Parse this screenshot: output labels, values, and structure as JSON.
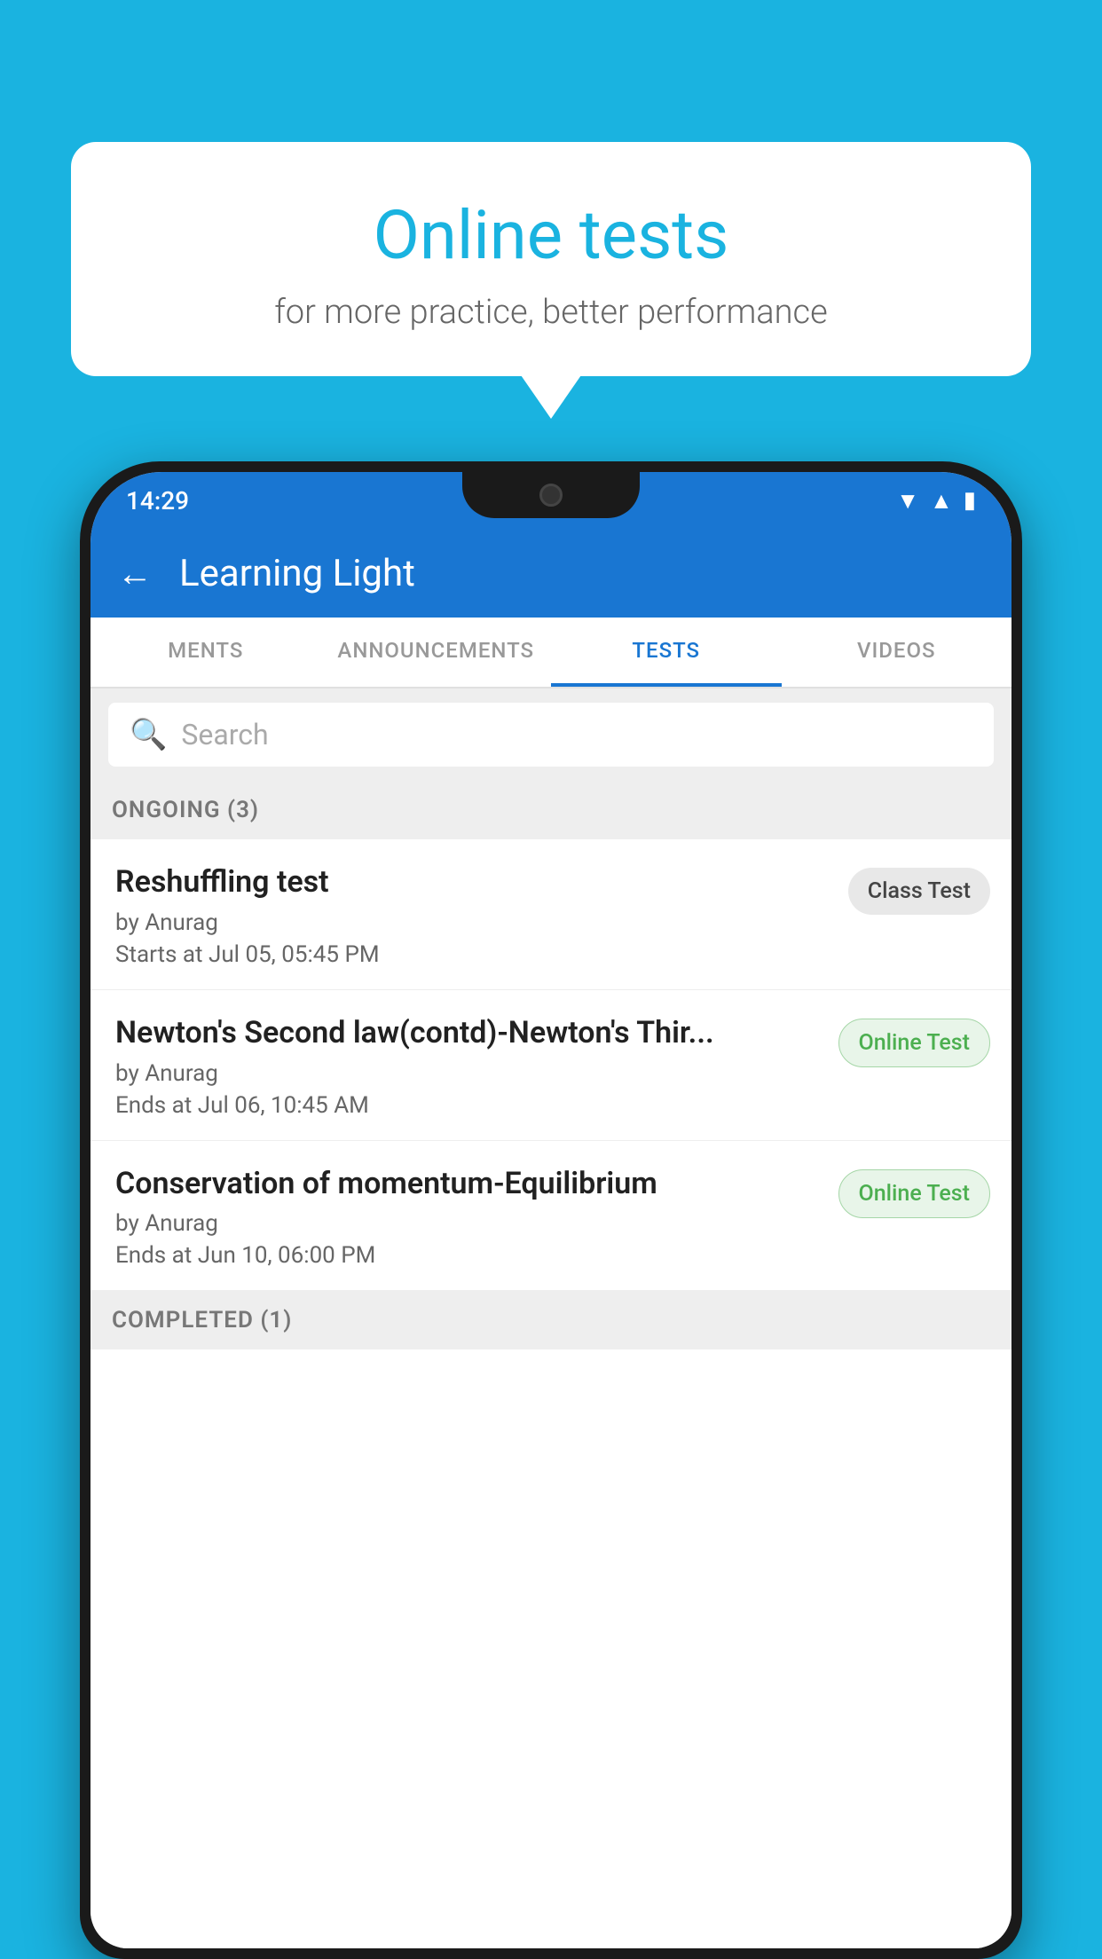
{
  "background_color": "#1ab3e0",
  "bubble": {
    "title": "Online tests",
    "subtitle": "for more practice, better performance"
  },
  "status_bar": {
    "time": "14:29",
    "icons": [
      "wifi",
      "signal",
      "battery"
    ]
  },
  "app_bar": {
    "title": "Learning Light",
    "back_label": "←"
  },
  "tabs": [
    {
      "label": "MENTS",
      "active": false
    },
    {
      "label": "ANNOUNCEMENTS",
      "active": false
    },
    {
      "label": "TESTS",
      "active": true
    },
    {
      "label": "VIDEOS",
      "active": false
    }
  ],
  "search": {
    "placeholder": "Search"
  },
  "section_ongoing": {
    "label": "ONGOING (3)"
  },
  "tests": [
    {
      "name": "Reshuffling test",
      "by": "by Anurag",
      "time": "Starts at  Jul 05, 05:45 PM",
      "badge": "Class Test",
      "badge_type": "class"
    },
    {
      "name": "Newton's Second law(contd)-Newton's Thir...",
      "by": "by Anurag",
      "time": "Ends at  Jul 06, 10:45 AM",
      "badge": "Online Test",
      "badge_type": "online"
    },
    {
      "name": "Conservation of momentum-Equilibrium",
      "by": "by Anurag",
      "time": "Ends at  Jun 10, 06:00 PM",
      "badge": "Online Test",
      "badge_type": "online"
    }
  ],
  "section_completed": {
    "label": "COMPLETED (1)"
  }
}
